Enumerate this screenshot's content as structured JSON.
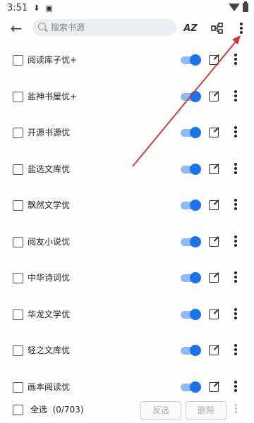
{
  "status_bar": {
    "time": "3:51",
    "icons": [
      "download-icon",
      "app-a-icon"
    ],
    "right_icons": [
      "wifi-icon",
      "battery-icon"
    ]
  },
  "toolbar": {
    "back_icon": "arrow-back-icon",
    "search_placeholder": "搜索书源",
    "sort_label": "AZ",
    "sort_icon": "sort-az-icon",
    "group_icon": "group-icon",
    "more_icon": "more-vert-icon"
  },
  "colors": {
    "switch_on_thumb": "#1a73e8",
    "switch_on_track": "#8fbaf7",
    "annotation_arrow": "#d0302a"
  },
  "sources": [
    {
      "name": "阅读库子优+",
      "checked": false,
      "enabled": true
    },
    {
      "name": "盐神书屋优+",
      "checked": false,
      "enabled": true
    },
    {
      "name": "开源书源优",
      "checked": false,
      "enabled": true
    },
    {
      "name": "盐选文库优",
      "checked": false,
      "enabled": true
    },
    {
      "name": "飘然文学优",
      "checked": false,
      "enabled": true
    },
    {
      "name": "阅友小说优",
      "checked": false,
      "enabled": true
    },
    {
      "name": "中华诗词优",
      "checked": false,
      "enabled": true
    },
    {
      "name": "华龙文学优",
      "checked": false,
      "enabled": true
    },
    {
      "name": "轻之文库优",
      "checked": false,
      "enabled": true
    },
    {
      "name": "画本阅读优",
      "checked": false,
      "enabled": true
    }
  ],
  "bottom_bar": {
    "select_all_label": "全选  (0/703)",
    "invert_label": "反选",
    "delete_label": "删除"
  }
}
